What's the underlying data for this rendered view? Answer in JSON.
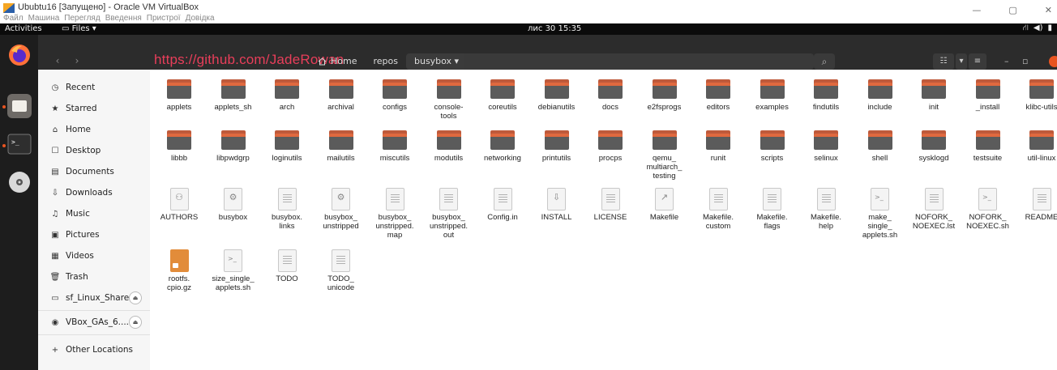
{
  "vbox": {
    "title": "Ububtu16 [Запущено] - Oracle VM VirtualBox",
    "menu": [
      "Файл",
      "Машина",
      "Перегляд",
      "Введення",
      "Пристрої",
      "Довідка"
    ]
  },
  "topbar": {
    "activities": "Activities",
    "app_menu": "Files ▾",
    "clock": "лис 30  15:35"
  },
  "watermark": "https://github.com/JadeRowan",
  "pathbar": {
    "home": "Home",
    "crumb1": "repos",
    "crumb2": "busybox ▾"
  },
  "sidebar": {
    "items": [
      {
        "label": "Recent",
        "icon": "clock-icon"
      },
      {
        "label": "Starred",
        "icon": "star-icon"
      },
      {
        "label": "Home",
        "icon": "home-icon"
      },
      {
        "label": "Desktop",
        "icon": "desktop-icon"
      },
      {
        "label": "Documents",
        "icon": "document-icon"
      },
      {
        "label": "Downloads",
        "icon": "download-icon"
      },
      {
        "label": "Music",
        "icon": "music-icon"
      },
      {
        "label": "Pictures",
        "icon": "picture-icon"
      },
      {
        "label": "Videos",
        "icon": "video-icon"
      },
      {
        "label": "Trash",
        "icon": "trash-icon"
      },
      {
        "label": "sf_Linux_Shared",
        "icon": "drive-icon"
      },
      {
        "label": "VBox_GAs_6....",
        "icon": "disc-icon"
      },
      {
        "label": "Other Locations",
        "icon": "plus-icon"
      }
    ]
  },
  "files": {
    "row1": [
      "applets",
      "applets_sh",
      "arch",
      "archival",
      "configs",
      "console-\ntools",
      "coreutils",
      "debianutils",
      "docs",
      "e2fsprogs",
      "editors",
      "examples",
      "findutils",
      "include",
      "init",
      "_install",
      "klibc-utils"
    ],
    "row2": [
      "libbb",
      "libpwdgrp",
      "loginutils",
      "mailutils",
      "miscutils",
      "modutils",
      "networking",
      "printutils",
      "procps",
      "qemu_\nmultiarch_\ntesting",
      "runit",
      "scripts",
      "selinux",
      "shell",
      "sysklogd",
      "testsuite",
      "util-linux"
    ],
    "row3": [
      "AUTHORS",
      "busybox",
      "busybox.\nlinks",
      "busybox_\nunstripped",
      "busybox_\nunstripped.\nmap",
      "busybox_\nunstripped.\nout",
      "Config.in",
      "INSTALL",
      "LICENSE",
      "Makefile",
      "Makefile.\ncustom",
      "Makefile.\nflags",
      "Makefile.\nhelp",
      "make_\nsingle_\napplets.sh",
      "NOFORK_\nNOEXEC.lst",
      "NOFORK_\nNOEXEC.sh",
      "README"
    ],
    "row4": [
      "rootfs.\ncpio.gz",
      "size_single_\napplets.sh",
      "TODO",
      "TODO_\nunicode"
    ]
  },
  "colors": {
    "accent": "#e95420",
    "watermark": "#e83e5a",
    "headerbar": "#2c2c2c"
  }
}
